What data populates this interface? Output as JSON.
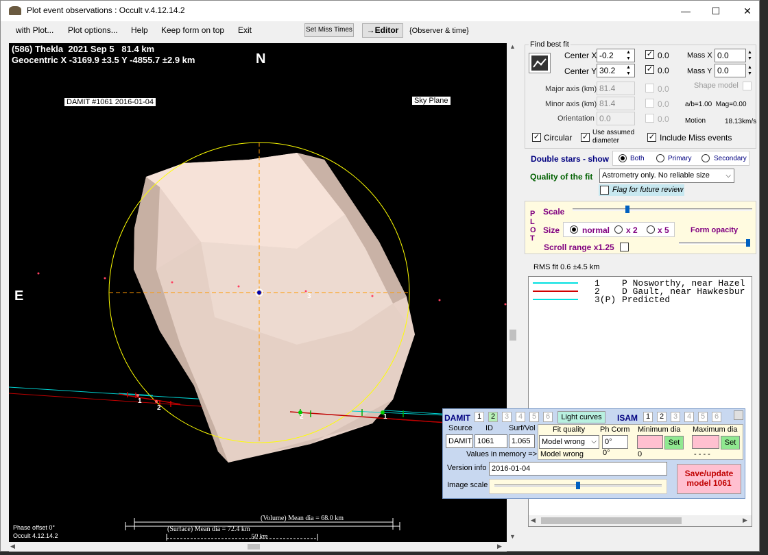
{
  "window": {
    "title": "Plot event observations : Occult v.4.12.14.2"
  },
  "menu": [
    "with Plot...",
    "Plot options...",
    "Help",
    "Keep form on top",
    "Exit"
  ],
  "toolbar": {
    "set_miss_times": "Set Miss Times",
    "editor": "→Editor",
    "observer_time": "{Observer & time}"
  },
  "plot": {
    "header1": "(586) Thekla  2021 Sep 5   81.4 km",
    "header2": "Geocentric  X  -3169.9 ±3.5  Y -4855.7 ±2.9 km",
    "north": "N",
    "east": "E",
    "damit_label": "DAMIT #1061 2016-01-04",
    "sky_plane": "Sky Plane",
    "chord_labels": [
      "1",
      "2",
      "2",
      "1",
      "3"
    ],
    "volume_dia": "(Volume) Mean dia = 68.0 km",
    "surface_dia": "(Surface) Mean dia = 72.4 km",
    "scale": "50 km",
    "phase": "Phase offset 0°",
    "version": "Occult 4.12.14.2"
  },
  "fit": {
    "title": "Find best fit",
    "center_x_label": "Center X",
    "center_x": "-0.2",
    "center_y_label": "Center Y",
    "center_y": "30.2",
    "center_x_zero": "0.0",
    "center_y_zero": "0.0",
    "mass_x_label": "Mass X",
    "mass_x": "0.0",
    "mass_y_label": "Mass Y",
    "mass_y": "0.0",
    "major_label": "Major axis (km)",
    "major": "81.4",
    "major_zero": "0.0",
    "minor_label": "Minor axis (km)",
    "minor": "81.4",
    "minor_zero": "0.0",
    "orient_label": "Orientation",
    "orient": "0.0",
    "orient_zero": "0.0",
    "shape_model": "Shape model",
    "ab": "a/b=1.00  Mag=0.00",
    "motion_label": "Motion",
    "motion": "18.13km/s",
    "circular": "Circular",
    "use_assumed": "Use assumed diameter",
    "include_miss": "Include Miss events"
  },
  "double": {
    "label": "Double stars - show",
    "both": "Both",
    "primary": "Primary",
    "secondary": "Secondary"
  },
  "quality": {
    "label": "Quality of the fit",
    "value": "Astrometry only. No reliable size",
    "flag": "Flag for future review"
  },
  "plotpanel": {
    "vertical": "PLOT",
    "scale": "Scale",
    "size": "Size",
    "normal": "normal",
    "x2": "x 2",
    "x5": "x 5",
    "opacity": "Form opacity",
    "scroll": "Scroll range x1.25",
    "scale_level": 0.3,
    "opacity_level": 1.0
  },
  "rms": "RMS fit 0.6 ±4.5 km",
  "legend": [
    {
      "num": "1",
      "name": "P Nosworthy, near Hazel",
      "color": "#00e0e0"
    },
    {
      "num": "2",
      "name": "D Gault, near Hawkesbur",
      "color": "#d00000"
    },
    {
      "num": "3(P)",
      "name": "Predicted",
      "color": "#00e0e0"
    }
  ],
  "damit": {
    "label": "DAMIT",
    "tabs": [
      "1",
      "2",
      "3",
      "4",
      "5",
      "6"
    ],
    "light_curves": "Light curves",
    "isam": "ISAM",
    "isam_tabs": [
      "1",
      "2",
      "3",
      "4",
      "5",
      "6"
    ],
    "source_h": "Source",
    "id_h": "ID",
    "surf_h": "Surf/Vol",
    "source": "DAMIT",
    "id": "1061",
    "surf": "1.065",
    "fitq_h": "Fit quality",
    "phcorr_h": "Ph Corm",
    "mindia_h": "Minimum dia",
    "maxdia_h": "Maximum dia",
    "fitq": "Model wrong",
    "phcorr": "0°",
    "set": "Set",
    "values_mem": "Values in memory =>",
    "mem_fitq": "Model wrong",
    "mem_ph": "0°",
    "mem_min": "0",
    "mem_max": "- - - -",
    "version_label": "Version info",
    "version": "2016-01-04",
    "image_scale": "Image scale",
    "image_scale_level": 0.5,
    "save": "Save/update model 1061"
  }
}
